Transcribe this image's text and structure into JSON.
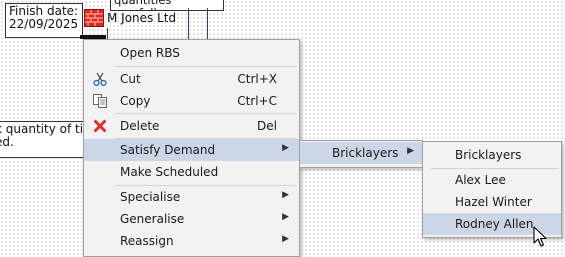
{
  "canvas": {
    "finish_label": "Finish date:",
    "finish_date": "22/09/2025",
    "task_resource": "M Jones Ltd",
    "note_top": "quantities carefully.",
    "note_left_line1": "k quantity of tin",
    "note_left_line2": "ed.",
    "task_icon": "brick-wall-icon"
  },
  "context_menu": {
    "items": [
      {
        "label": "Open RBS",
        "shortcut": "",
        "icon": "",
        "submenu": false
      },
      {
        "label": "Cut",
        "shortcut": "Ctrl+X",
        "icon": "scissors-icon",
        "submenu": false
      },
      {
        "label": "Copy",
        "shortcut": "Ctrl+C",
        "icon": "copy-icon",
        "submenu": false
      },
      {
        "label": "Delete",
        "shortcut": "Del",
        "icon": "delete-x-icon",
        "submenu": false
      },
      {
        "label": "Satisfy Demand",
        "shortcut": "",
        "icon": "",
        "submenu": true,
        "highlighted": true
      },
      {
        "label": "Make Scheduled",
        "shortcut": "",
        "icon": "",
        "submenu": false
      },
      {
        "label": "Specialise",
        "shortcut": "",
        "icon": "",
        "submenu": true
      },
      {
        "label": "Generalise",
        "shortcut": "",
        "icon": "",
        "submenu": true
      },
      {
        "label": "Reassign",
        "shortcut": "",
        "icon": "",
        "submenu": true
      }
    ]
  },
  "submenu_satisfy": {
    "items": [
      {
        "label": "Bricklayers",
        "submenu": true,
        "highlighted": true
      }
    ]
  },
  "submenu_bricklayers": {
    "header": "Bricklayers",
    "items": [
      {
        "label": "Alex Lee"
      },
      {
        "label": "Hazel Winter"
      },
      {
        "label": "Rodney Allen",
        "highlighted": true
      }
    ]
  },
  "colors": {
    "menu_bg": "#f2f2f2",
    "highlight": "#ccd6e6",
    "delete_red": "#d9302a",
    "task_red": "#e0262a"
  }
}
